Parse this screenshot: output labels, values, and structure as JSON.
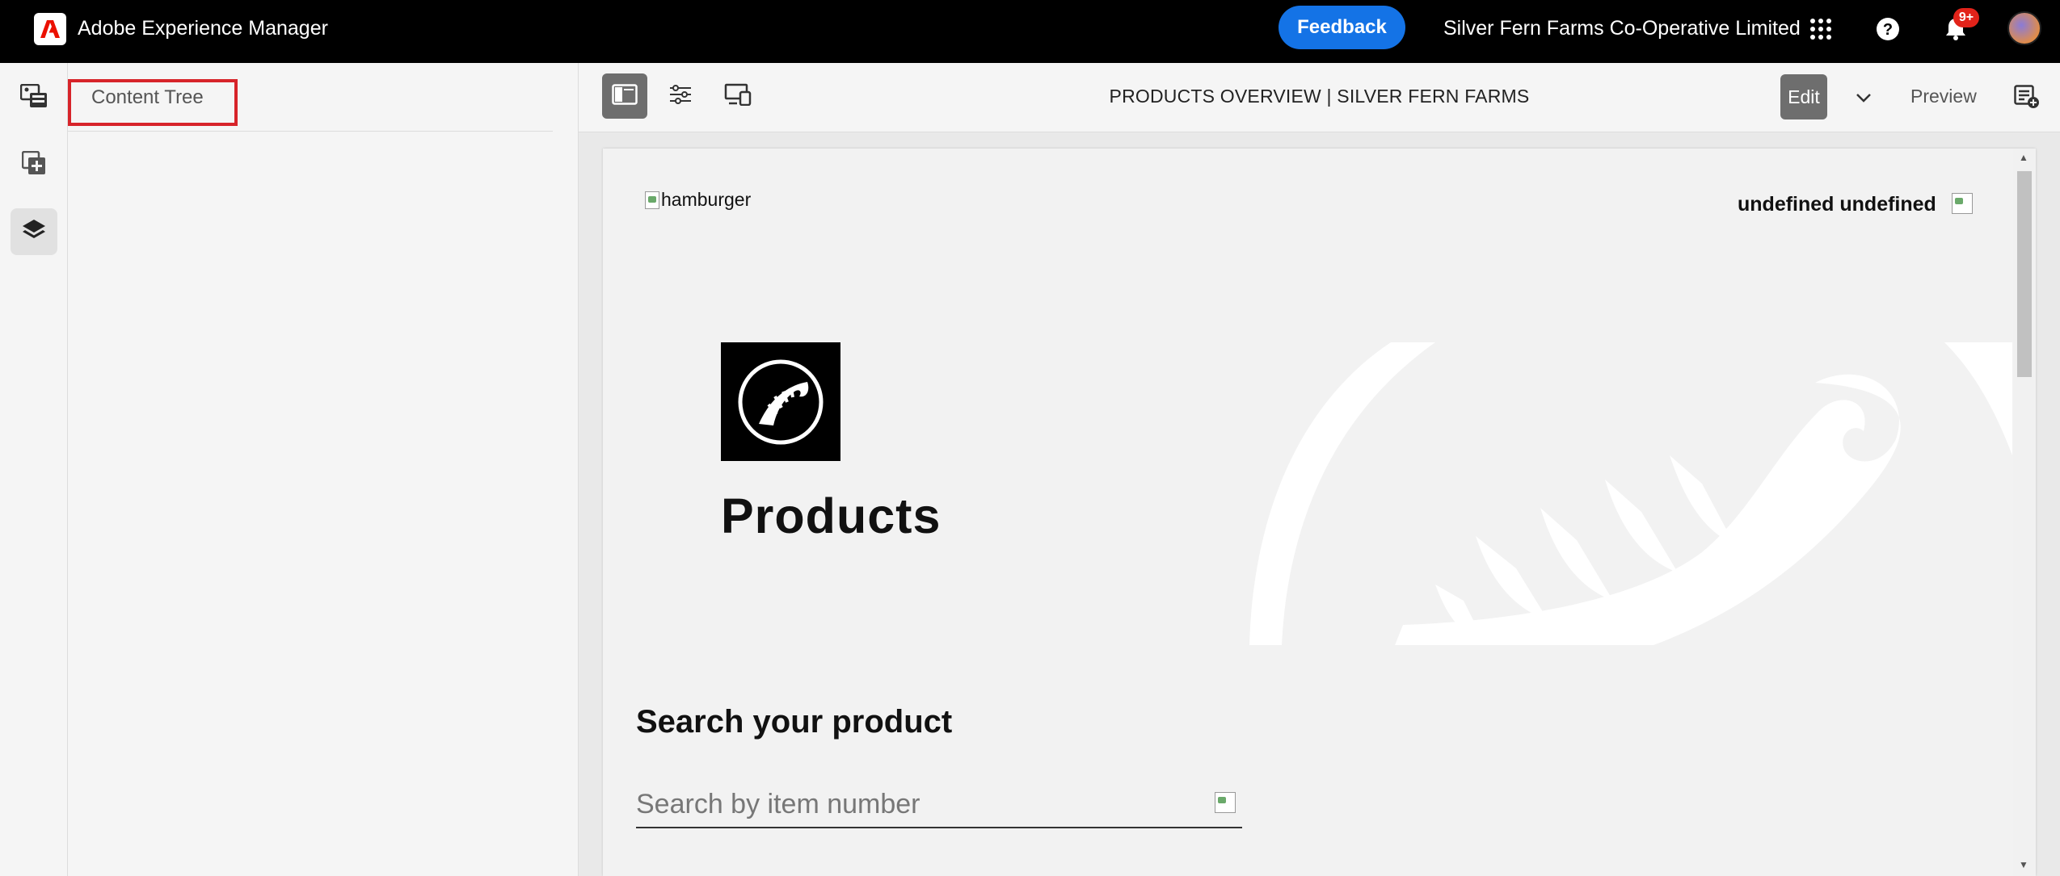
{
  "topbar": {
    "app_title": "Adobe Experience Manager",
    "feedback_label": "Feedback",
    "org_name": "Silver Fern Farms Co-Operative Limited",
    "notification_count": "9+"
  },
  "sidepanel": {
    "title": "Content Tree"
  },
  "editor": {
    "page_title": "PRODUCTS OVERVIEW | SILVER FERN FARMS",
    "edit_label": "Edit",
    "preview_label": "Preview"
  },
  "page": {
    "hamburger_alt": "hamburger",
    "user_name": "undefined undefined",
    "hero_title": "Products",
    "search_heading": "Search your product",
    "search_placeholder": "Search by item number"
  },
  "colors": {
    "topbar_bg": "#000000",
    "feedback_blue": "#1473e6",
    "highlight_red": "#d7242a",
    "adobe_red": "#eb1000"
  }
}
